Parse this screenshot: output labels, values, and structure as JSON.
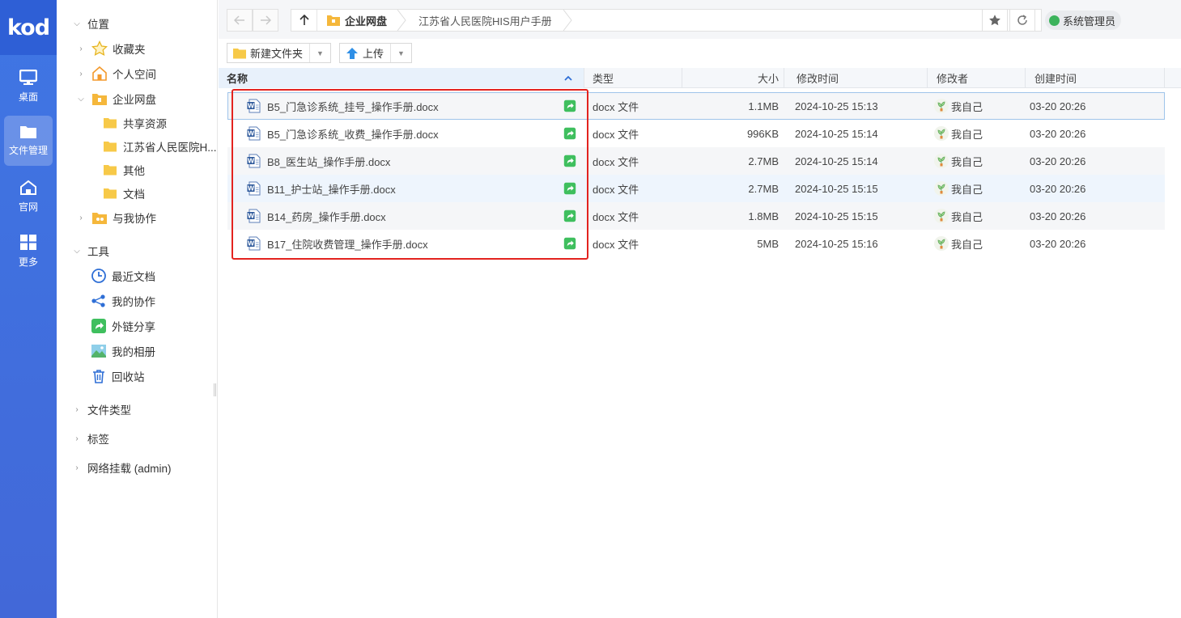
{
  "app": {
    "logo": "kod"
  },
  "rail": [
    {
      "label": "桌面",
      "icon": "monitor-icon"
    },
    {
      "label": "文件管理",
      "icon": "folder-icon",
      "active": true
    },
    {
      "label": "官网",
      "icon": "home-icon"
    },
    {
      "label": "更多",
      "icon": "grid-icon"
    }
  ],
  "tree": {
    "location": "位置",
    "favorites": "收藏夹",
    "personal": "个人空间",
    "enterprise": "企业网盘",
    "shared": "共享资源",
    "hospital": "江苏省人民医院H...",
    "other": "其他",
    "docs": "文档",
    "collab_with_me": "与我协作",
    "tools": "工具",
    "recent": "最近文档",
    "my_collab": "我的协作",
    "link_share": "外链分享",
    "album": "我的相册",
    "recycle": "回收站",
    "file_types": "文件类型",
    "tags": "标签",
    "network_mount": "网络挂载 (admin)"
  },
  "address": {
    "crumb_root": "企业网盘",
    "crumb_current": "江苏省人民医院HIS用户手册",
    "user": "系统管理员"
  },
  "toolbar": {
    "new_folder": "新建文件夹",
    "upload": "上传"
  },
  "columns": {
    "name": "名称",
    "type": "类型",
    "size": "大小",
    "modified": "修改时间",
    "modifier": "修改者",
    "created": "创建时间"
  },
  "files": [
    {
      "name": "B5_门急诊系统_挂号_操作手册.docx",
      "type": "docx 文件",
      "size": "1.1MB",
      "modified": "2024-10-25 15:13",
      "modifier": "我自己",
      "created": "03-20 20:26"
    },
    {
      "name": "B5_门急诊系统_收费_操作手册.docx",
      "type": "docx 文件",
      "size": "996KB",
      "modified": "2024-10-25 15:14",
      "modifier": "我自己",
      "created": "03-20 20:26"
    },
    {
      "name": "B8_医生站_操作手册.docx",
      "type": "docx 文件",
      "size": "2.7MB",
      "modified": "2024-10-25 15:14",
      "modifier": "我自己",
      "created": "03-20 20:26"
    },
    {
      "name": "B11_护士站_操作手册.docx",
      "type": "docx 文件",
      "size": "2.7MB",
      "modified": "2024-10-25 15:15",
      "modifier": "我自己",
      "created": "03-20 20:26"
    },
    {
      "name": "B14_药房_操作手册.docx",
      "type": "docx 文件",
      "size": "1.8MB",
      "modified": "2024-10-25 15:15",
      "modifier": "我自己",
      "created": "03-20 20:26"
    },
    {
      "name": "B17_住院收费管理_操作手册.docx",
      "type": "docx 文件",
      "size": "5MB",
      "modified": "2024-10-25 15:16",
      "modifier": "我自己",
      "created": "03-20 20:26"
    }
  ],
  "colors": {
    "rail": "#3f76e4",
    "highlight_box": "#e3231f",
    "share_green": "#3fbf5e",
    "folder_yellow": "#f5c244"
  }
}
